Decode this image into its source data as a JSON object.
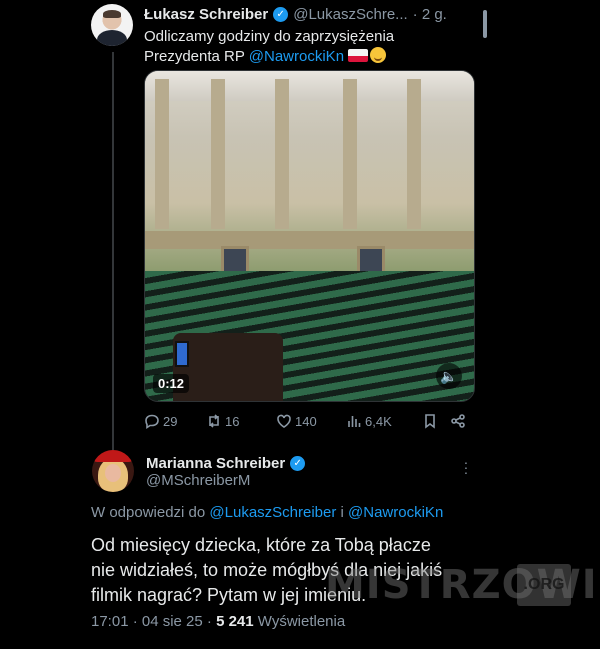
{
  "tweet": {
    "author_name": "Łukasz Schreiber",
    "author_handle": "@LukaszSchre...",
    "time_ago": "· 2 g.",
    "text_line1": "Odliczamy godziny do zaprzysiężenia",
    "text_line2_prefix": "Prezydenta RP ",
    "mention": "@NawrockiKn",
    "video_time": "0:12",
    "stats": {
      "replies": "29",
      "reposts": "16",
      "likes": "140",
      "views": "6,4K"
    }
  },
  "reply": {
    "author_name": "Marianna Schreiber",
    "author_handle": "@MSchreiberM",
    "reply_to_prefix": "W odpowiedzi do ",
    "reply_to_user1": "@LukaszSchreiber",
    "reply_to_sep": " i ",
    "reply_to_user2": "@NawrockiKn",
    "text_line1": "Od miesięcy dziecka, które za Tobą płacze",
    "text_line2": "nie widziałeś, to może mógłbyś dla niej jakiś",
    "text_line3": "filmik nagrać? Pytam w jej imieniu.",
    "meta_time": "17:01 · 04 sie 25 · ",
    "meta_views": "5 241",
    "meta_views_label": " Wyświetlenia"
  },
  "watermark": {
    "text": "MISTRZOWIE",
    "suffix": ".ORG"
  },
  "colors": {
    "background": "#000000",
    "accent": "#1d9bf0",
    "muted": "#8b98a5",
    "text": "#e7e9ea"
  },
  "icons": [
    "verified-badge-icon",
    "more-icon",
    "reply-icon",
    "repost-icon",
    "like-icon",
    "views-icon",
    "bookmark-icon",
    "share-icon",
    "mute-icon",
    "flag-poland-icon",
    "smile-emoji-icon"
  ]
}
